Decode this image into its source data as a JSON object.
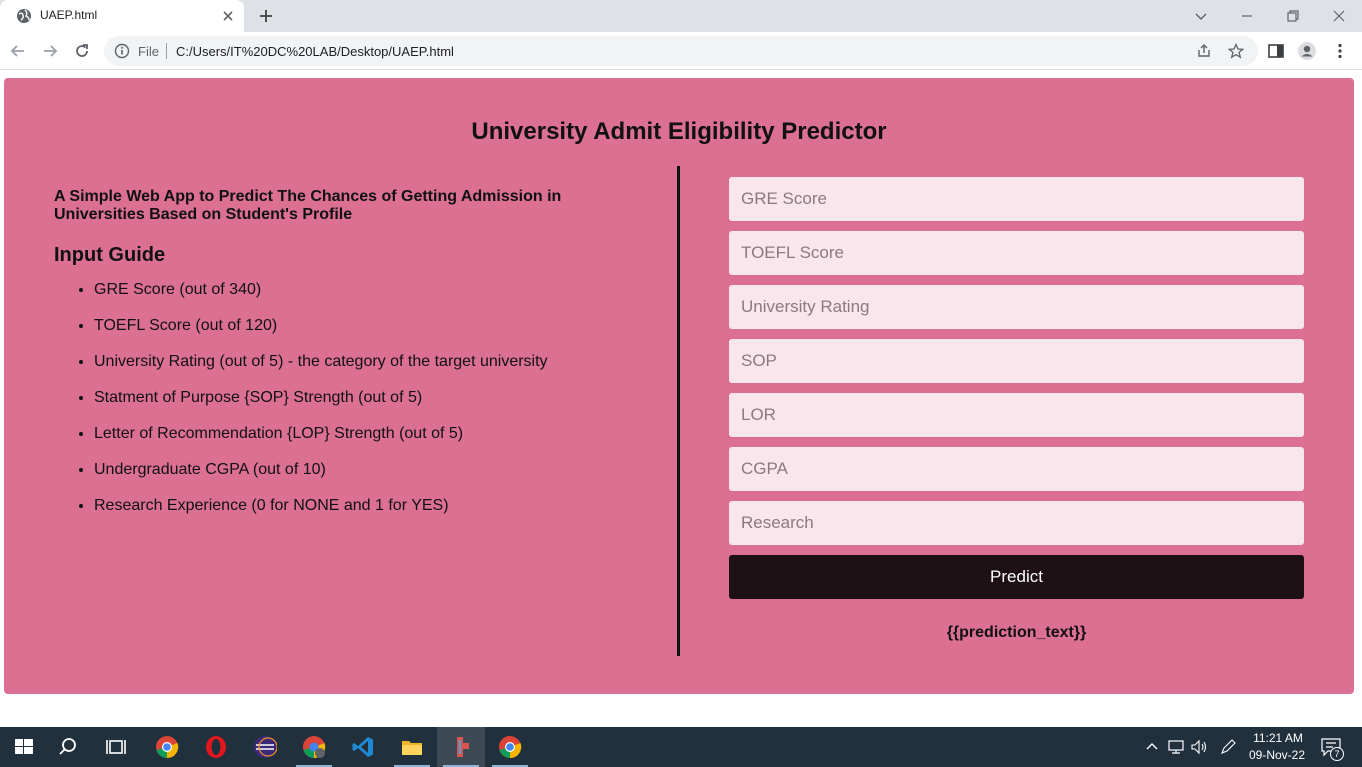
{
  "browser": {
    "tab_title": "UAEP.html",
    "scheme_label": "File",
    "url": "C:/Users/IT%20DC%20LAB/Desktop/UAEP.html"
  },
  "page": {
    "title": "University Admit Eligibility Predictor",
    "subtitle": "A Simple Web App to Predict The Chances of Getting Admission in Universities Based on Student's Profile",
    "guide_heading": "Input Guide",
    "guide_items": [
      "GRE Score (out of 340)",
      "TOEFL Score (out of 120)",
      "University Rating (out of 5) - the category of the target university",
      "Statment of Purpose {SOP} Strength (out of 5)",
      "Letter of Recommendation {LOP} Strength (out of 5)",
      "Undergraduate CGPA (out of 10)",
      "Research Experience (0 for NONE and 1 for YES)"
    ],
    "form": {
      "gre_placeholder": "GRE Score",
      "toefl_placeholder": "TOEFL Score",
      "rating_placeholder": "University Rating",
      "sop_placeholder": "SOP",
      "lor_placeholder": "LOR",
      "cgpa_placeholder": "CGPA",
      "research_placeholder": "Research",
      "predict_label": "Predict"
    },
    "prediction_text": "{{prediction_text}}"
  },
  "taskbar": {
    "time": "11:21 AM",
    "date": "09-Nov-22",
    "notification_count": "7"
  },
  "colors": {
    "page_bg": "#db7092",
    "input_bg": "#f9e5ec",
    "button_bg": "#1e1115",
    "taskbar_bg": "#20303c"
  }
}
